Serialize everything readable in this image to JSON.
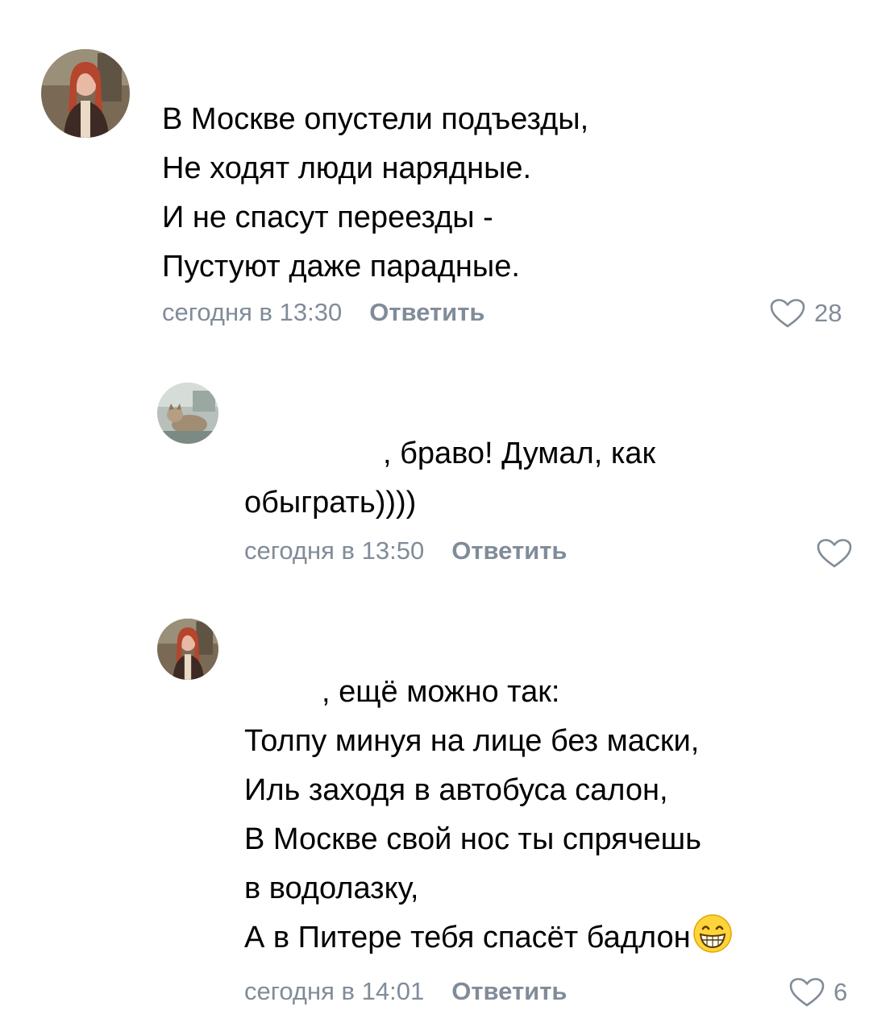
{
  "comments": [
    {
      "lines": [
        "В Москве опустели подъезды,",
        "Не ходят люди нарядные.",
        "И не спасут переезды -",
        "Пустуют даже парадные."
      ],
      "time": "сегодня в 13:30",
      "reply_label": "Ответить",
      "likes": "28",
      "avatar": "avatar-red-haired-woman"
    },
    {
      "lines": [
        ", браво! Думал, как",
        "обыграть))))"
      ],
      "time": "сегодня в 13:50",
      "reply_label": "Ответить",
      "likes": "",
      "avatar": "avatar-cat-photo"
    },
    {
      "lines": [
        ", ещё можно так:",
        "Толпу минуя на лице без маски,",
        "Иль заходя в автобуса салон,",
        "В Москве свой нос ты спрячешь",
        "в водолазку,",
        "А в Питере тебя спасёт бадлон"
      ],
      "emoji": "grinning-face-emoji",
      "time": "сегодня в 14:01",
      "reply_label": "Ответить",
      "likes": "6",
      "avatar": "avatar-red-haired-woman"
    }
  ],
  "colors": {
    "text": "#000000",
    "meta": "#818c99"
  }
}
